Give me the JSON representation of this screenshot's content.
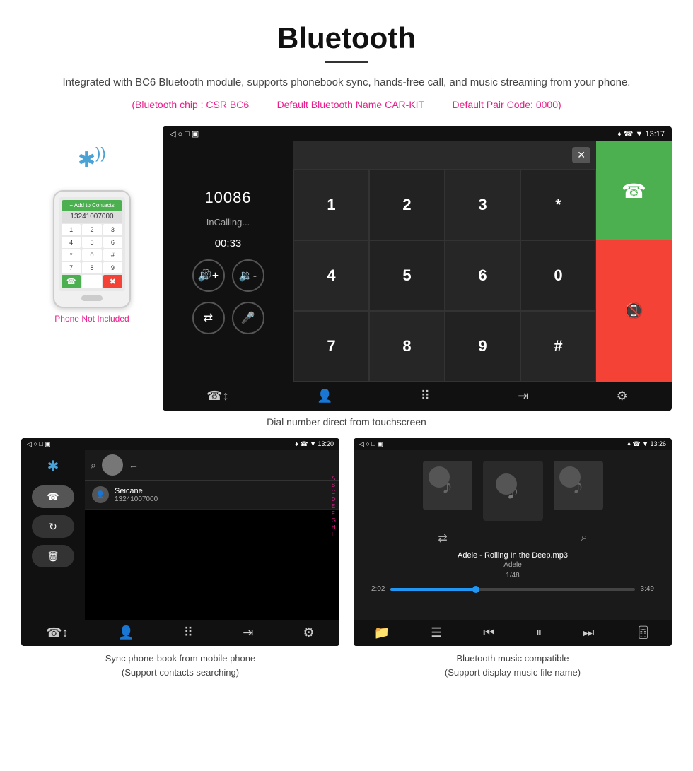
{
  "header": {
    "title": "Bluetooth",
    "description": "Integrated with BC6 Bluetooth module, supports phonebook sync, hands-free call, and music streaming from your phone.",
    "spec_chip": "(Bluetooth chip : CSR BC6",
    "spec_name": "Default Bluetooth Name CAR-KIT",
    "spec_code": "Default Pair Code: 0000)",
    "phone_not_included": "Phone Not Included"
  },
  "main_screen": {
    "status_bar": {
      "left_icons": "◁  ○  □  ▣",
      "right_icons": "♦ ☎ ▼ 13:17"
    },
    "dial_number": "10086",
    "dial_status": "InCalling...",
    "dial_timer": "00:33",
    "numpad": [
      "1",
      "2",
      "3",
      "*",
      "4",
      "5",
      "6",
      "0",
      "7",
      "8",
      "9",
      "#"
    ],
    "caption": "Dial number direct from touchscreen"
  },
  "phonebook_screen": {
    "status_bar_left": "◁  ○  □  ▣",
    "status_bar_right": "♦ ☎ ▼ 13:20",
    "contact_name": "Seicane",
    "contact_number": "13241007000",
    "alphabet": [
      "A",
      "B",
      "C",
      "D",
      "E",
      "F",
      "G",
      "H",
      "I"
    ],
    "caption_line1": "Sync phone-book from mobile phone",
    "caption_line2": "(Support contacts searching)"
  },
  "music_screen": {
    "status_bar_left": "◁  ○  □  ▣",
    "status_bar_right": "♦ ☎ ▼ 13:26",
    "track_name": "Adele - Rolling In the Deep.mp3",
    "artist": "Adele",
    "track_count": "1/48",
    "time_current": "2:02",
    "time_total": "3:49",
    "caption_line1": "Bluetooth music compatible",
    "caption_line2": "(Support display music file name)"
  },
  "icons": {
    "bluetooth": "✱",
    "phone": "☎",
    "music_note": "♪",
    "search": "⌕",
    "volume_up": "🔊",
    "volume_down": "🔉",
    "transfer": "⇄",
    "mic": "🎤",
    "call": "📞",
    "end_call": "📵",
    "back": "←",
    "shuffle": "⇄",
    "prev": "⏮",
    "play": "⏸",
    "next": "⏭",
    "eq": "☰"
  }
}
